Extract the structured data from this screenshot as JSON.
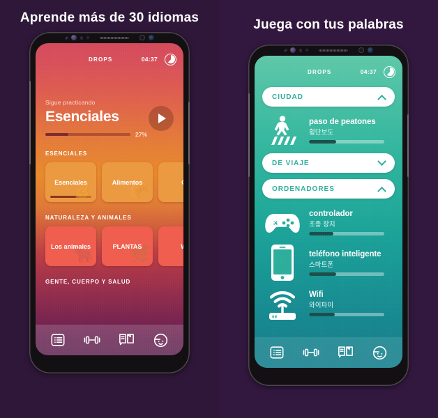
{
  "panels": {
    "left": {
      "headline": "Aprende más de 30 idiomas",
      "app": {
        "brand": "DROPS",
        "timer": "04:37",
        "timer_icon": "timer-ring-icon"
      },
      "hero": {
        "kicker": "Sigue practicando",
        "title": "Esenciales",
        "progress_pct": "27%",
        "progress_value": 27,
        "play_icon": "play-icon"
      },
      "categories": [
        {
          "label": "ESENCIALES",
          "tiles": [
            {
              "title": "Esenciales",
              "color": "#ec9a42",
              "glyph": "✌",
              "progress": 62
            },
            {
              "title": "Alimentos",
              "color": "#ec9a42",
              "glyph": "🥐",
              "progress": 0
            },
            {
              "title": "C",
              "color": "#ec9a42",
              "glyph": "",
              "progress": 0
            }
          ]
        },
        {
          "label": "NATURALEZA Y ANIMALES",
          "tiles": [
            {
              "title": "Los animales",
              "color": "#ef5e4f",
              "glyph": "🐂",
              "progress": 0
            },
            {
              "title": "PLANTAS",
              "color": "#ef5e4f",
              "glyph": "🌿",
              "progress": 0
            },
            {
              "title": "W",
              "color": "#ef5e4f",
              "glyph": "",
              "progress": 0
            }
          ]
        },
        {
          "label": "GENTE, CUERPO Y SALUD",
          "tiles": []
        }
      ],
      "nav": [
        {
          "name": "list-icon",
          "label": "Topics"
        },
        {
          "name": "dumbbell-icon",
          "label": "Practice"
        },
        {
          "name": "dictionary-icon",
          "label": "Dictionary"
        },
        {
          "name": "profile-face-icon",
          "label": "Profile"
        }
      ]
    },
    "right": {
      "headline": "Juega con tus palabras",
      "app": {
        "brand": "DROPS",
        "timer": "04:37",
        "timer_icon": "timer-ring-icon"
      },
      "sections": [
        {
          "label": "CIUDAD",
          "expanded": true,
          "chevron": "chevron-up-icon",
          "words": [
            {
              "es": "paso de peatones",
              "ko": "횡단보도",
              "icon": "crosswalk-icon",
              "progress": 36
            }
          ]
        },
        {
          "label": "DE VIAJE",
          "expanded": false,
          "chevron": "chevron-down-icon",
          "words": []
        },
        {
          "label": "ORDENADORES",
          "expanded": true,
          "chevron": "chevron-up-icon",
          "words": [
            {
              "es": "controlador",
              "ko": "조종 장치",
              "icon": "gamepad-icon",
              "progress": 32
            },
            {
              "es": "teléfono inteligente",
              "ko": "스마트폰",
              "icon": "smartphone-icon",
              "progress": 36
            },
            {
              "es": "Wifi",
              "ko": "와이파이",
              "icon": "wifi-router-icon",
              "progress": 34
            }
          ]
        }
      ],
      "nav": [
        {
          "name": "list-icon",
          "label": "Topics"
        },
        {
          "name": "dumbbell-icon",
          "label": "Practice"
        },
        {
          "name": "dictionary-icon",
          "label": "Dictionary"
        },
        {
          "name": "profile-face-icon",
          "label": "Profile"
        }
      ]
    }
  },
  "colors": {
    "background": "#30173c",
    "warm_top": "#d44a5c",
    "warm_mid": "#e98a2d",
    "warm_bottom": "#5b1e4c",
    "cool_top": "#5fc8a8",
    "cool_bottom": "#17808d",
    "accent_teal": "#2eaf9b",
    "tile_orange": "#ec9a42",
    "tile_red": "#ef5e4f"
  }
}
